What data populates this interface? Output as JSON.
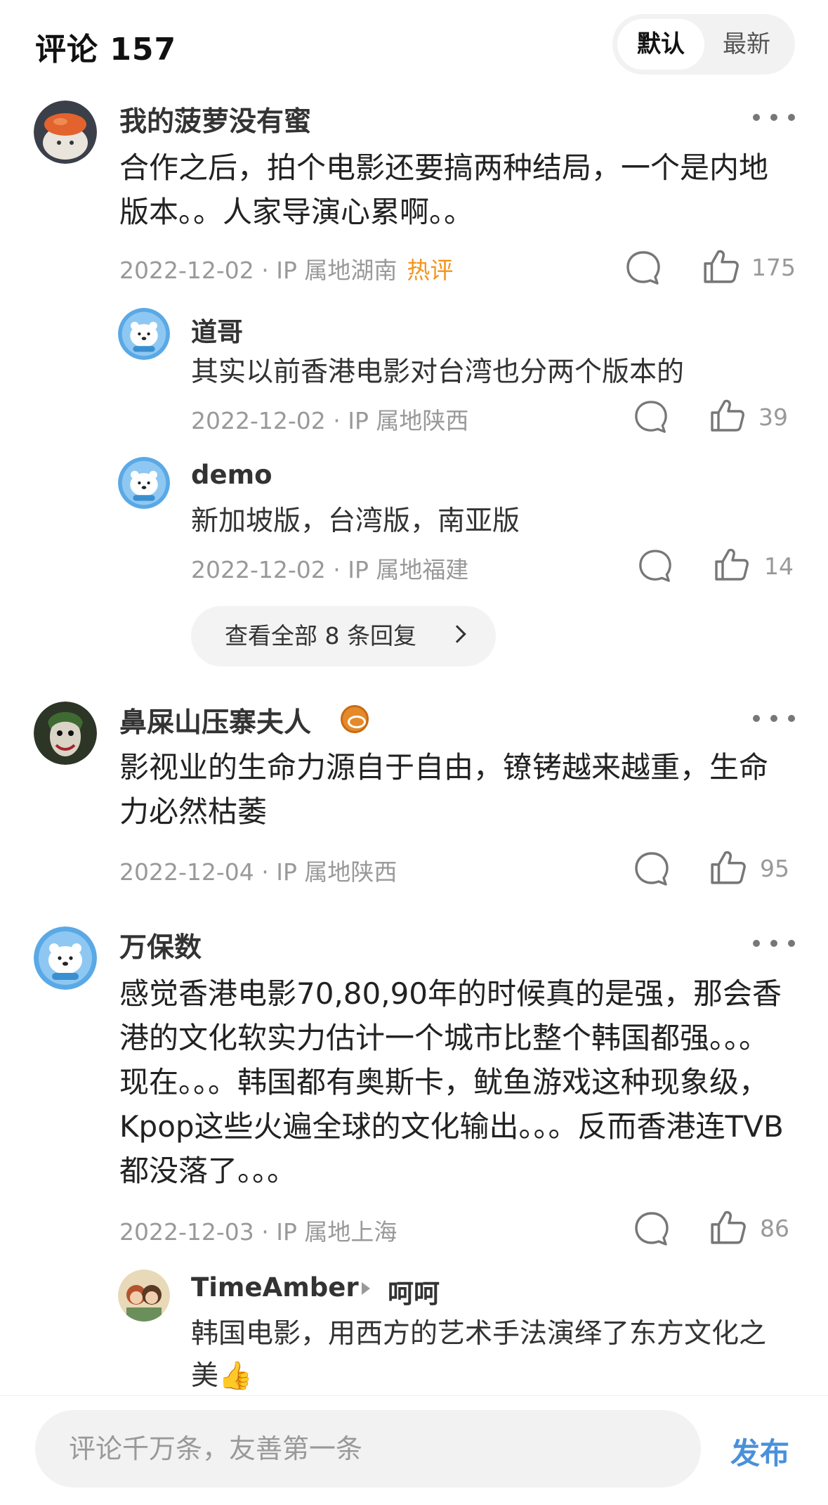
{
  "header": {
    "title": "评论 157",
    "sort_default": "默认",
    "sort_latest": "最新"
  },
  "comments": [
    {
      "username": "我的菠萝没有蜜",
      "text": "合作之后，拍个电影还要搞两种结局，一个是内地版本。。人家导演心累啊。。",
      "meta": "2022-12-02 · IP 属地湖南",
      "hot_tag": "热评",
      "likes": "175",
      "replies": [
        {
          "username": "道哥",
          "text": "其实以前香港电影对台湾也分两个版本的",
          "meta": "2022-12-02 · IP 属地陕西",
          "likes": "39"
        },
        {
          "username": "demo",
          "text": "新加坡版，台湾版，南亚版",
          "meta": "2022-12-02 · IP 属地福建",
          "likes": "14"
        }
      ],
      "view_all_label": "查看全部 8 条回复"
    },
    {
      "username": "鼻屎山压寨夫人",
      "text": "影视业的生命力源自于自由，镣铐越来越重，生命力必然枯萎",
      "meta": "2022-12-04 · IP 属地陕西",
      "likes": "95"
    },
    {
      "username": "万保数",
      "text": "感觉香港电影70,80,90年的时候真的是强，那会香港的文化软实力估计一个城市比整个韩国都强。。。现在。。。韩国都有奥斯卡，鱿鱼游戏这种现象级，Kpop这些火遍全球的文化输出。。。反而香港连TVB都没落了。。。",
      "meta": "2022-12-03 · IP 属地上海",
      "likes": "86",
      "replies": [
        {
          "username": "TimeAmber",
          "reply_to": "呵呵",
          "text": "韩国电影，用西方的艺术手法演绎了东方文化之美👍"
        }
      ]
    }
  ],
  "bottom": {
    "input_placeholder": "评论千万条，友善第一条",
    "publish_label": "发布"
  },
  "colors": {
    "hot": "#f4941a",
    "publish": "#4a90d9",
    "meta": "#999999"
  }
}
